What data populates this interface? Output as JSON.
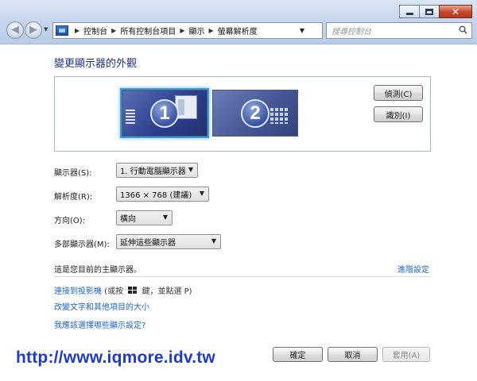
{
  "toolbar": {
    "breadcrumbs": [
      "控制台",
      "所有控制台項目",
      "顯示",
      "螢幕解析度"
    ],
    "search_placeholder": "搜尋控制台"
  },
  "main": {
    "title": "變更顯示器的外觀",
    "monitors": [
      {
        "number": "1",
        "selected": true
      },
      {
        "number": "2",
        "selected": false
      }
    ],
    "detect_button": "偵測(C)",
    "identify_button": "識別(I)",
    "fields": {
      "display_label": "顯示器(S):",
      "display_value": "1. 行動電腦顯示器",
      "resolution_label": "解析度(R):",
      "resolution_value": "1366 × 768 (建議)",
      "orientation_label": "方向(O):",
      "orientation_value": "橫向",
      "multi_display_label": "多部顯示器(M):",
      "multi_display_value": "延伸這些顯示器"
    },
    "status_text": "這是您目前的主顯示器。",
    "advanced_link": "進階設定",
    "links": {
      "projector_link": "連接到投影機",
      "projector_hint_prefix": " (或按 ",
      "projector_hint_suffix": " 鍵，並點選 P)",
      "text_size_link": "改變文字和其他項目的大小",
      "which_settings_link": "我應該選擇哪些顯示設定?"
    }
  },
  "footer": {
    "watermark_url": "http://www.iqmore.idv.tw",
    "ok_button": "確定",
    "cancel_button": "取消",
    "apply_button": "套用(A)"
  },
  "colors": {
    "link": "#1c65c4",
    "title": "#1e3287",
    "watermark": "#1c3bd6",
    "close_button": "#c6452c",
    "selection_glow": "#3e98e8"
  }
}
